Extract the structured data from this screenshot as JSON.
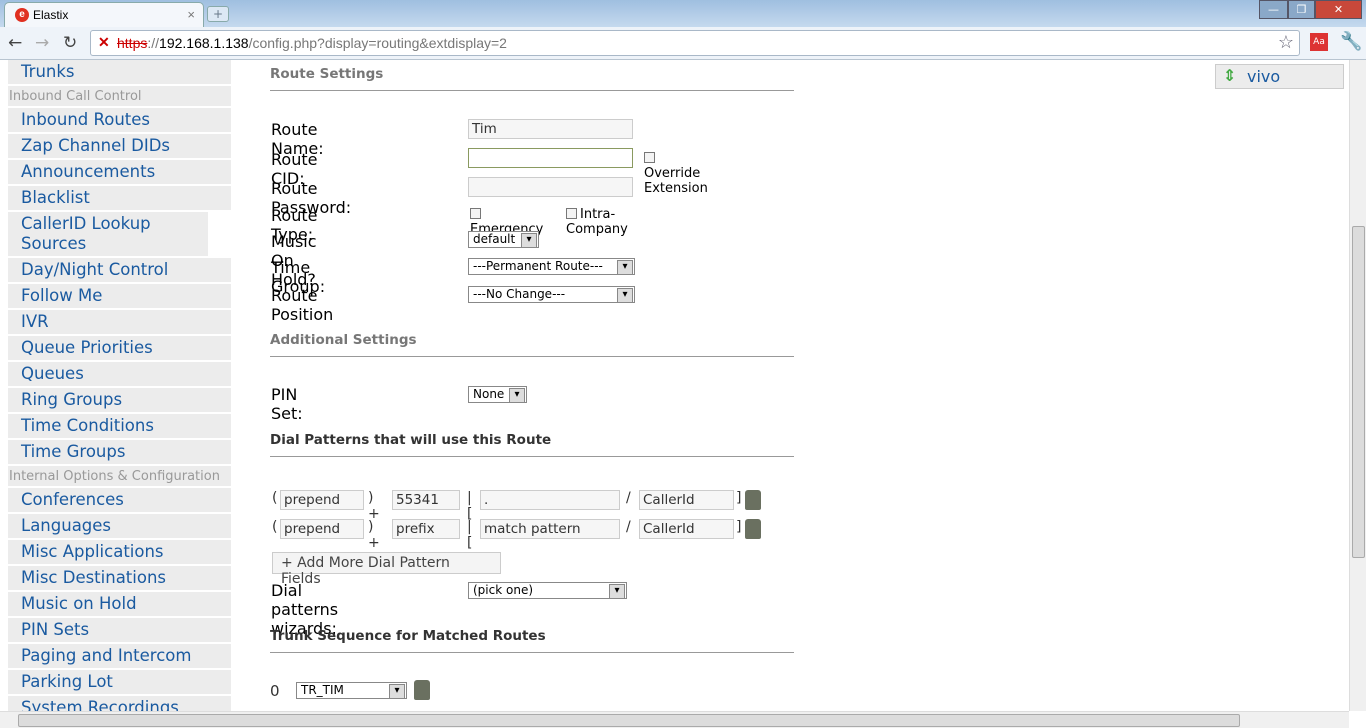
{
  "browser": {
    "tab_title": "Elastix",
    "url_scheme": "https",
    "url_host": "192.168.1.138",
    "url_path": "/config.php?display=routing&extdisplay=2"
  },
  "sidebar": {
    "items": [
      {
        "label": "Trunks",
        "type": "link"
      },
      {
        "label": "Inbound Call Control",
        "type": "header"
      },
      {
        "label": "Inbound Routes",
        "type": "link"
      },
      {
        "label": "Zap Channel DIDs",
        "type": "link"
      },
      {
        "label": "Announcements",
        "type": "link"
      },
      {
        "label": "Blacklist",
        "type": "link"
      },
      {
        "label": "CallerID Lookup Sources",
        "type": "link2"
      },
      {
        "label": "Day/Night Control",
        "type": "link"
      },
      {
        "label": "Follow Me",
        "type": "link"
      },
      {
        "label": "IVR",
        "type": "link"
      },
      {
        "label": "Queue Priorities",
        "type": "link"
      },
      {
        "label": "Queues",
        "type": "link"
      },
      {
        "label": "Ring Groups",
        "type": "link"
      },
      {
        "label": "Time Conditions",
        "type": "link"
      },
      {
        "label": "Time Groups",
        "type": "link"
      },
      {
        "label": "Internal Options & Configuration",
        "type": "header"
      },
      {
        "label": "Conferences",
        "type": "link"
      },
      {
        "label": "Languages",
        "type": "link"
      },
      {
        "label": "Misc Applications",
        "type": "link"
      },
      {
        "label": "Misc Destinations",
        "type": "link"
      },
      {
        "label": "Music on Hold",
        "type": "link"
      },
      {
        "label": "PIN Sets",
        "type": "link"
      },
      {
        "label": "Paging and Intercom",
        "type": "link"
      },
      {
        "label": "Parking Lot",
        "type": "link"
      },
      {
        "label": "System Recordings",
        "type": "link"
      }
    ]
  },
  "route_settings": {
    "heading": "Route Settings",
    "route_name_label": "Route Name:",
    "route_name": "Tim",
    "route_cid_label": "Route CID:",
    "route_cid": "",
    "override_extension": "Override Extension",
    "route_password_label": "Route Password:",
    "route_password": "",
    "route_type_label": "Route Type:",
    "emergency": "Emergency",
    "intra_company": "Intra-Company",
    "moh_label": "Music On Hold?",
    "moh": "default",
    "time_group_label": "Time Group:",
    "time_group": "---Permanent Route---",
    "position_label": "Route Position",
    "position": "---No Change---"
  },
  "additional": {
    "heading": "Additional Settings",
    "pin_label": "PIN Set:",
    "pin": "None"
  },
  "dial_patterns": {
    "heading": "Dial Patterns that will use this Route",
    "rows": [
      {
        "prepend": "prepend",
        "prefix": "55341",
        "match": ".",
        "callerid": "CallerId"
      },
      {
        "prepend": "prepend",
        "prefix": "prefix",
        "match": "match pattern",
        "callerid": "CallerId"
      }
    ],
    "add_button": "+ Add More Dial Pattern Fields",
    "wizard_label": "Dial patterns wizards:",
    "wizard": "(pick one)"
  },
  "trunks": {
    "heading": "Trunk Sequence for Matched Routes",
    "rows": [
      {
        "index": "0",
        "trunk": "TR_TIM"
      }
    ]
  },
  "user_badge": "vivo"
}
